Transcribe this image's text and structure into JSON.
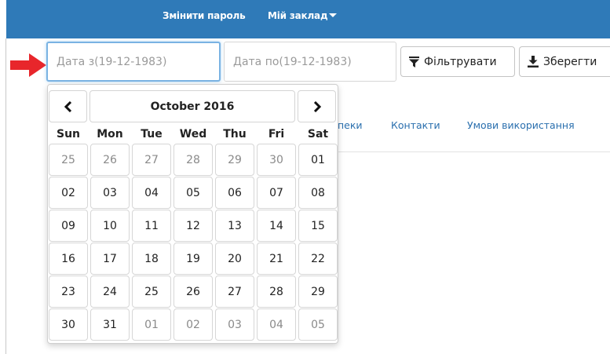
{
  "topbar": {
    "links": [
      "Змінити пароль",
      "Мій заклад"
    ]
  },
  "filters": {
    "date_from_placeholder": "Дата з(19-12-1983)",
    "date_to_placeholder": "Дата по(19-12-1983)",
    "filter_label": "Фільтрувати",
    "save_label": "Зберегти"
  },
  "subnav": [
    "пеки",
    "Контакти",
    "Умови використання"
  ],
  "datepicker": {
    "month_label": "October 2016",
    "prev_icon": "chevron-left-icon",
    "next_icon": "chevron-right-icon",
    "weekdays": [
      "Sun",
      "Mon",
      "Tue",
      "Wed",
      "Thu",
      "Fri",
      "Sat"
    ],
    "weeks": [
      [
        {
          "d": "25",
          "m": true
        },
        {
          "d": "26",
          "m": true
        },
        {
          "d": "27",
          "m": true
        },
        {
          "d": "28",
          "m": true
        },
        {
          "d": "29",
          "m": true
        },
        {
          "d": "30",
          "m": true
        },
        {
          "d": "01",
          "m": false
        }
      ],
      [
        {
          "d": "02",
          "m": false
        },
        {
          "d": "03",
          "m": false
        },
        {
          "d": "04",
          "m": false
        },
        {
          "d": "05",
          "m": false
        },
        {
          "d": "06",
          "m": false
        },
        {
          "d": "07",
          "m": false
        },
        {
          "d": "08",
          "m": false
        }
      ],
      [
        {
          "d": "09",
          "m": false
        },
        {
          "d": "10",
          "m": false
        },
        {
          "d": "11",
          "m": false
        },
        {
          "d": "12",
          "m": false
        },
        {
          "d": "13",
          "m": false
        },
        {
          "d": "14",
          "m": false
        },
        {
          "d": "15",
          "m": false
        }
      ],
      [
        {
          "d": "16",
          "m": false
        },
        {
          "d": "17",
          "m": false
        },
        {
          "d": "18",
          "m": false
        },
        {
          "d": "19",
          "m": false
        },
        {
          "d": "20",
          "m": false
        },
        {
          "d": "21",
          "m": false
        },
        {
          "d": "22",
          "m": false
        }
      ],
      [
        {
          "d": "23",
          "m": false
        },
        {
          "d": "24",
          "m": false
        },
        {
          "d": "25",
          "m": false
        },
        {
          "d": "26",
          "m": false
        },
        {
          "d": "27",
          "m": false
        },
        {
          "d": "28",
          "m": false
        },
        {
          "d": "29",
          "m": false
        }
      ],
      [
        {
          "d": "30",
          "m": false
        },
        {
          "d": "31",
          "m": false
        },
        {
          "d": "01",
          "m": true
        },
        {
          "d": "02",
          "m": true
        },
        {
          "d": "03",
          "m": true
        },
        {
          "d": "04",
          "m": true
        },
        {
          "d": "05",
          "m": true
        }
      ]
    ]
  },
  "colors": {
    "navbar": "#2f7ab8",
    "arrow": "#e8262b",
    "link": "#2a6fae"
  }
}
